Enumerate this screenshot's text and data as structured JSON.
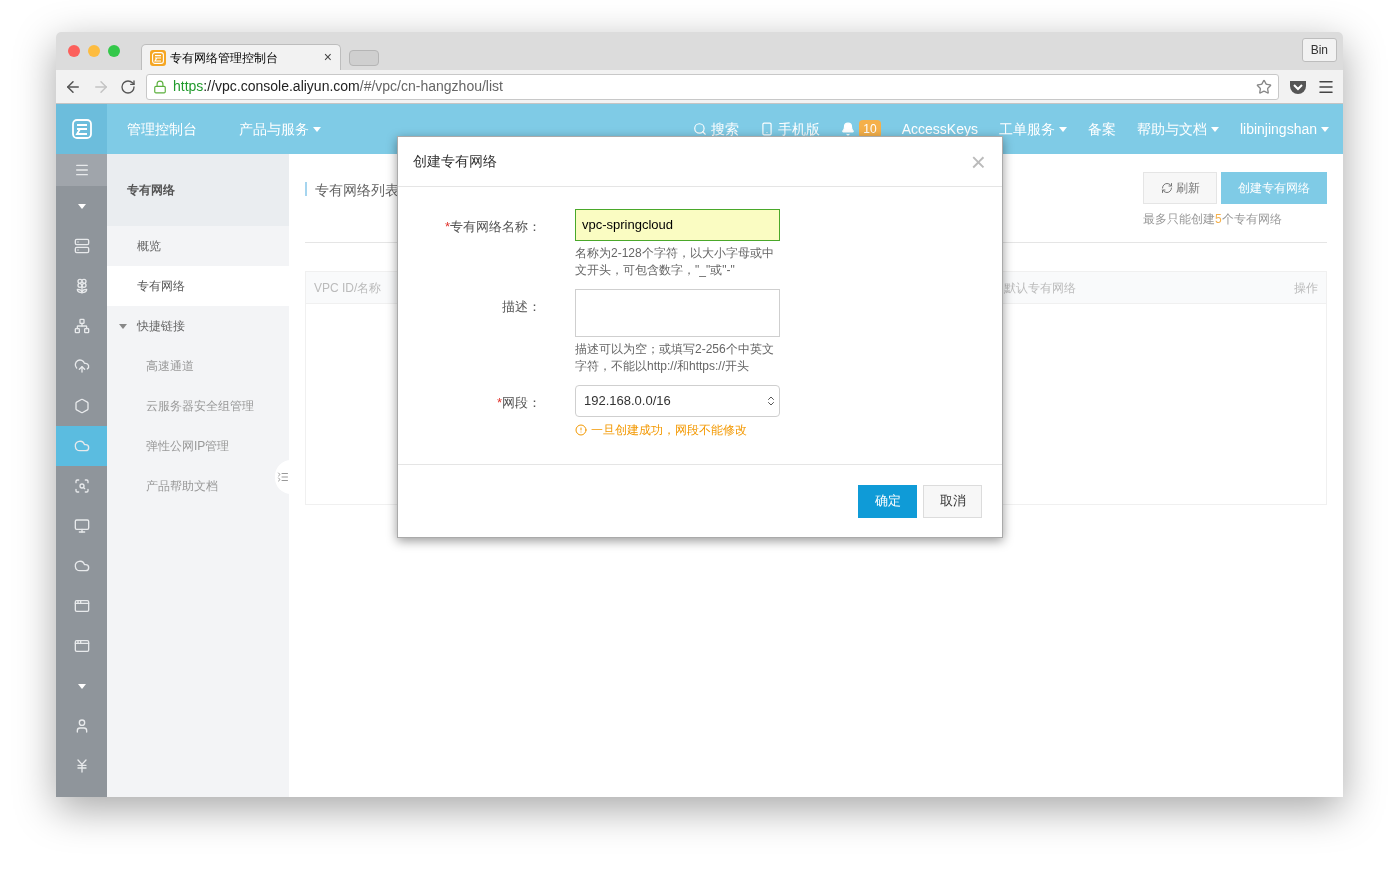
{
  "browser": {
    "tab": {
      "title": "专有网络管理控制台",
      "close": "×"
    },
    "profile": "Bin",
    "url": {
      "scheme": "https",
      "host": "://vpc.console.aliyun.com",
      "path": "/#/vpc/cn-hangzhou/list"
    }
  },
  "topbar": {
    "brand": "管理控制台",
    "left_menu": [
      {
        "label": "产品与服务",
        "dropdown": true
      }
    ],
    "right_menu": [
      {
        "kind": "search",
        "label": "搜索",
        "dropdown": false
      },
      {
        "kind": "mobile",
        "label": "手机版",
        "dropdown": false
      },
      {
        "kind": "bell",
        "badge": "10",
        "dropdown": false
      },
      {
        "kind": "link",
        "label": "AccessKeys",
        "dropdown": false
      },
      {
        "kind": "link",
        "label": "工单服务",
        "dropdown": true
      },
      {
        "kind": "link",
        "label": "备案",
        "dropdown": false
      },
      {
        "kind": "link",
        "label": "帮助与文档",
        "dropdown": true
      },
      {
        "kind": "link",
        "label": "libinjingshan",
        "dropdown": true
      }
    ]
  },
  "icon_rail": [
    {
      "kind": "menu",
      "selected": false
    },
    {
      "kind": "caret",
      "selected": false
    },
    {
      "kind": "server",
      "selected": false
    },
    {
      "kind": "flower",
      "selected": false
    },
    {
      "kind": "network",
      "selected": false
    },
    {
      "kind": "upload",
      "selected": false
    },
    {
      "kind": "hexagon",
      "selected": false
    },
    {
      "kind": "cloud",
      "selected": true
    },
    {
      "kind": "scan",
      "selected": false
    },
    {
      "kind": "monitor",
      "selected": false
    },
    {
      "kind": "cloud-outline",
      "selected": false
    },
    {
      "kind": "app",
      "selected": false
    },
    {
      "kind": "app",
      "selected": false
    },
    {
      "kind": "caret",
      "selected": false
    },
    {
      "kind": "user",
      "selected": false
    },
    {
      "kind": "yen",
      "selected": false
    }
  ],
  "sidebar": {
    "title": "专有网络",
    "items": [
      {
        "label": "概览",
        "selected": false
      },
      {
        "label": "专有网络",
        "selected": true
      }
    ],
    "section": {
      "label": "快捷链接",
      "expanded": true,
      "children": [
        {
          "label": "高速通道"
        },
        {
          "label": "云服务器安全组管理"
        },
        {
          "label": "弹性公网IP管理"
        },
        {
          "label": "产品帮助文档"
        }
      ]
    }
  },
  "main": {
    "title": "专有网络列表",
    "refresh_button": "刷新",
    "create_button": "创建专有网络",
    "limit_note": {
      "prefix": "最多只能创建",
      "count": "5",
      "suffix": "个专有网络"
    },
    "table": {
      "columns": [
        "VPC ID/名称",
        "默认专有网络",
        "操作"
      ]
    }
  },
  "dialog": {
    "title": "创建专有网络",
    "close": "×",
    "fields": [
      {
        "kind": "text",
        "mark": "*",
        "label": "专有网络名称：",
        "value": "vpc-springcloud",
        "hint": "名称为2-128个字符，以大小字母或中文开头，可包含数字，\"_\"或\"-\""
      },
      {
        "kind": "textarea",
        "label": "描述：",
        "hint": "描述可以为空；或填写2-256个中英文字符，不能以http://和https://开头"
      },
      {
        "kind": "select",
        "mark": "*",
        "label": "网段：",
        "value": "192.168.0.0/16",
        "warning": "一旦创建成功，网段不能修改"
      }
    ],
    "confirm_button": "确定",
    "cancel_button": "取消"
  }
}
